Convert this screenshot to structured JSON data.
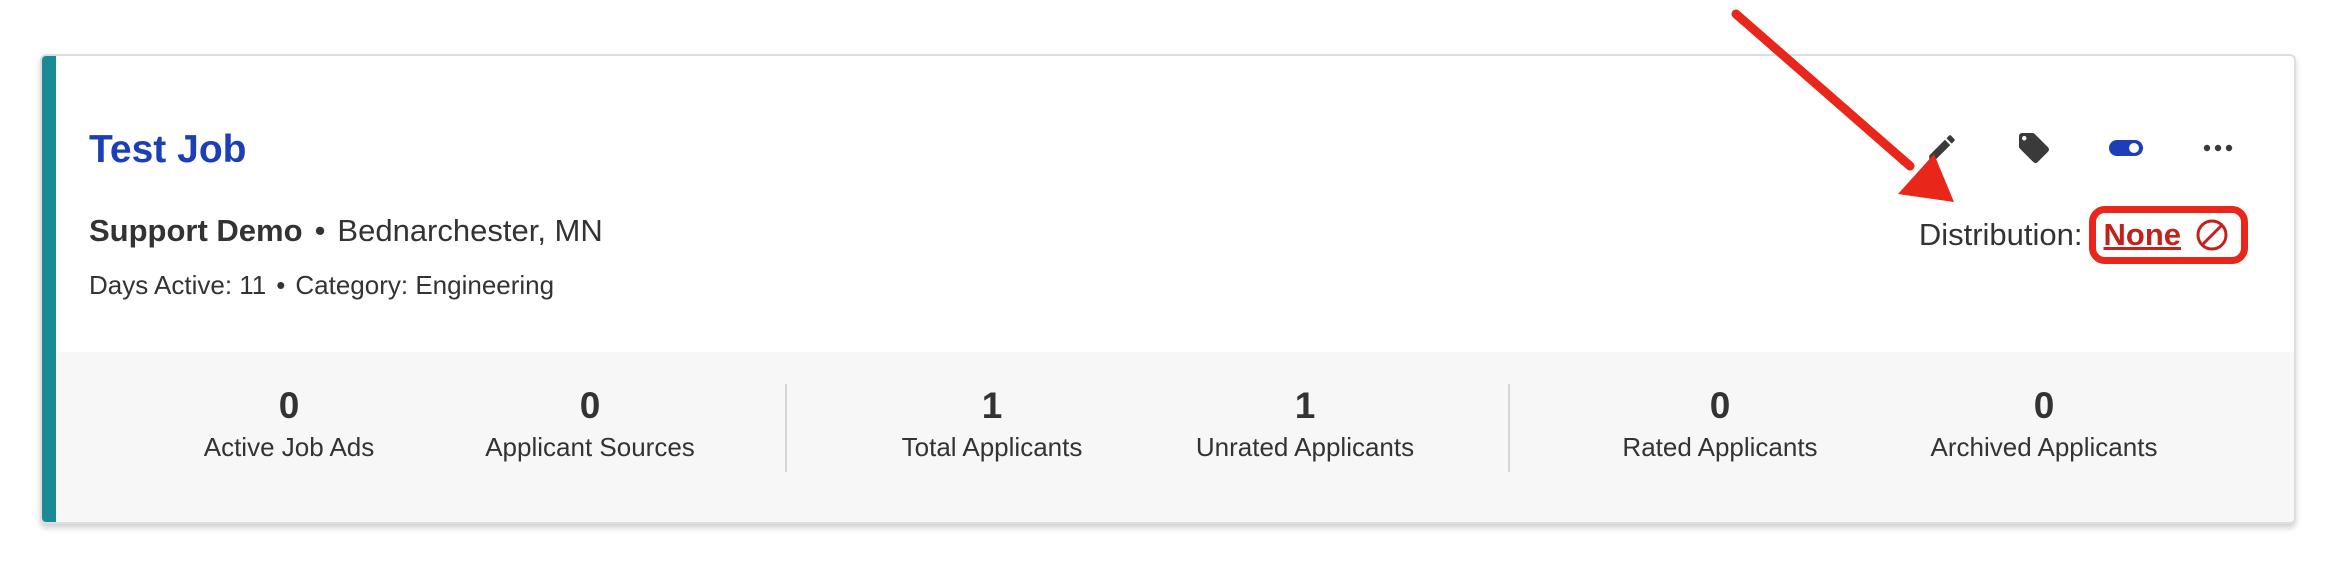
{
  "job": {
    "title": "Test Job",
    "company": "Support Demo",
    "separator": "•",
    "location": "Bednarchester, MN",
    "days_active": "Days Active: 11",
    "category": "Category: Engineering"
  },
  "actions": [
    {
      "icon": "pencil-icon",
      "name": "edit"
    },
    {
      "icon": "tag-icon",
      "name": "tags"
    },
    {
      "icon": "toggle-icon",
      "name": "status-toggle"
    },
    {
      "icon": "more-icon",
      "name": "more"
    }
  ],
  "distribution": {
    "label": "Distribution:",
    "value": "None",
    "icon": "prohibited-icon"
  },
  "stats": [
    {
      "value": "0",
      "label": "Active Job Ads"
    },
    {
      "value": "0",
      "label": "Applicant Sources"
    },
    {
      "value": "1",
      "label": "Total Applicants"
    },
    {
      "value": "1",
      "label": "Unrated Applicants"
    },
    {
      "value": "0",
      "label": "Rated Applicants"
    },
    {
      "value": "0",
      "label": "Archived Applicants"
    }
  ],
  "colors": {
    "accent_bar": "#1a8a96",
    "title": "#1c3fb7",
    "distribution_none": "#c2221a",
    "annotation": "#e8261a",
    "toggle": "#1c3fb7"
  }
}
